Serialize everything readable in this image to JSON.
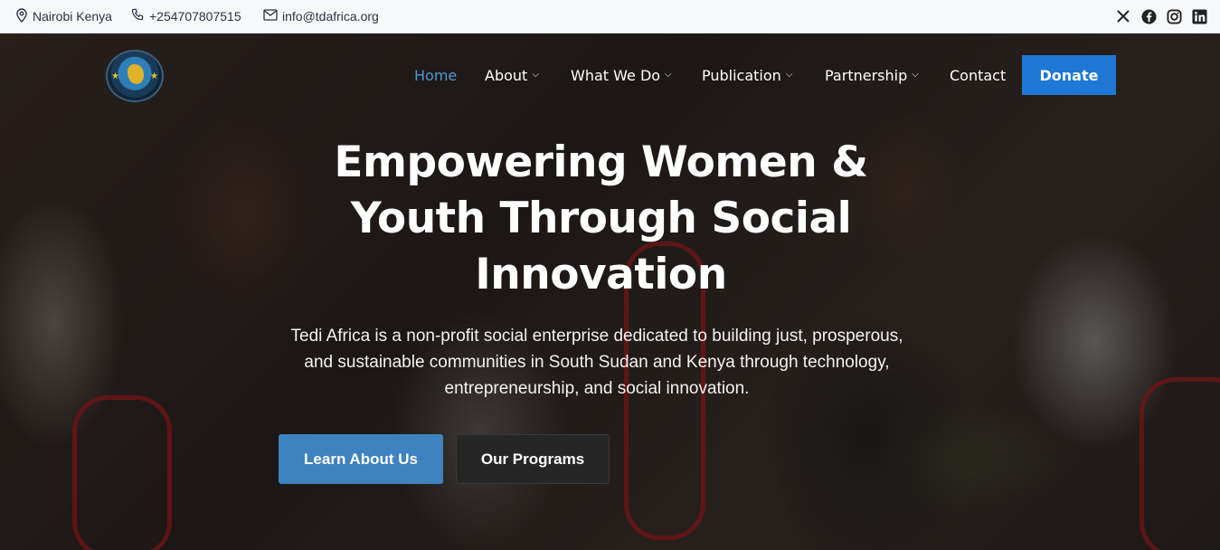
{
  "topbar": {
    "location": "Nairobi Kenya",
    "phone": "+254707807515",
    "email": "info@tdafrica.org",
    "social_icons": [
      "x-icon",
      "facebook-icon",
      "instagram-icon",
      "linkedin-icon"
    ]
  },
  "nav": {
    "items": [
      {
        "label": "Home",
        "active": true
      },
      {
        "label": "About",
        "dropdown": true
      },
      {
        "label": "What We Do",
        "dropdown": true
      },
      {
        "label": "Publication",
        "dropdown": true
      },
      {
        "label": "Partnership",
        "dropdown": true
      },
      {
        "label": "Contact"
      }
    ],
    "donate_label": "Donate"
  },
  "hero": {
    "headline_line1": "Empowering Women &",
    "headline_line2": "Youth Through Social",
    "headline_line3": "Innovation",
    "subtext_line1": "Tedi Africa is a non-profit social enterprise dedicated to building just, prosperous,",
    "subtext_line2": "and sustainable communities in South Sudan and Kenya through technology,",
    "subtext_line3": "entrepreneurship, and social innovation.",
    "primary_button": "Learn About Us",
    "secondary_button": "Our Programs"
  },
  "colors": {
    "accent": "#1f78d6",
    "active_nav": "#4a9ad6",
    "primary_button": "#3f82c0",
    "secondary_button": "#262626",
    "topbar_bg": "#f7f8fa"
  }
}
